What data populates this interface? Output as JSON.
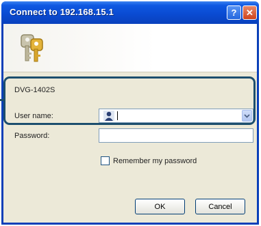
{
  "window": {
    "title": "Connect to 192.168.15.1",
    "help_glyph": "?",
    "close_glyph": "✕"
  },
  "dialog": {
    "device_name": "DVG-1402S",
    "username_label": "User name:",
    "username_value": "",
    "password_label": "Password:",
    "password_value": "",
    "remember_label": "Remember my password",
    "remember_checked": false,
    "ok_label": "OK",
    "cancel_label": "Cancel"
  },
  "colors": {
    "titlebar": "#0a4ad0",
    "highlight_border": "#1c4e6e",
    "dialog_bg": "#ece9d8"
  },
  "icons": {
    "banner": "keys-icon",
    "user": "user-icon",
    "dropdown": "chevron-down-icon"
  }
}
